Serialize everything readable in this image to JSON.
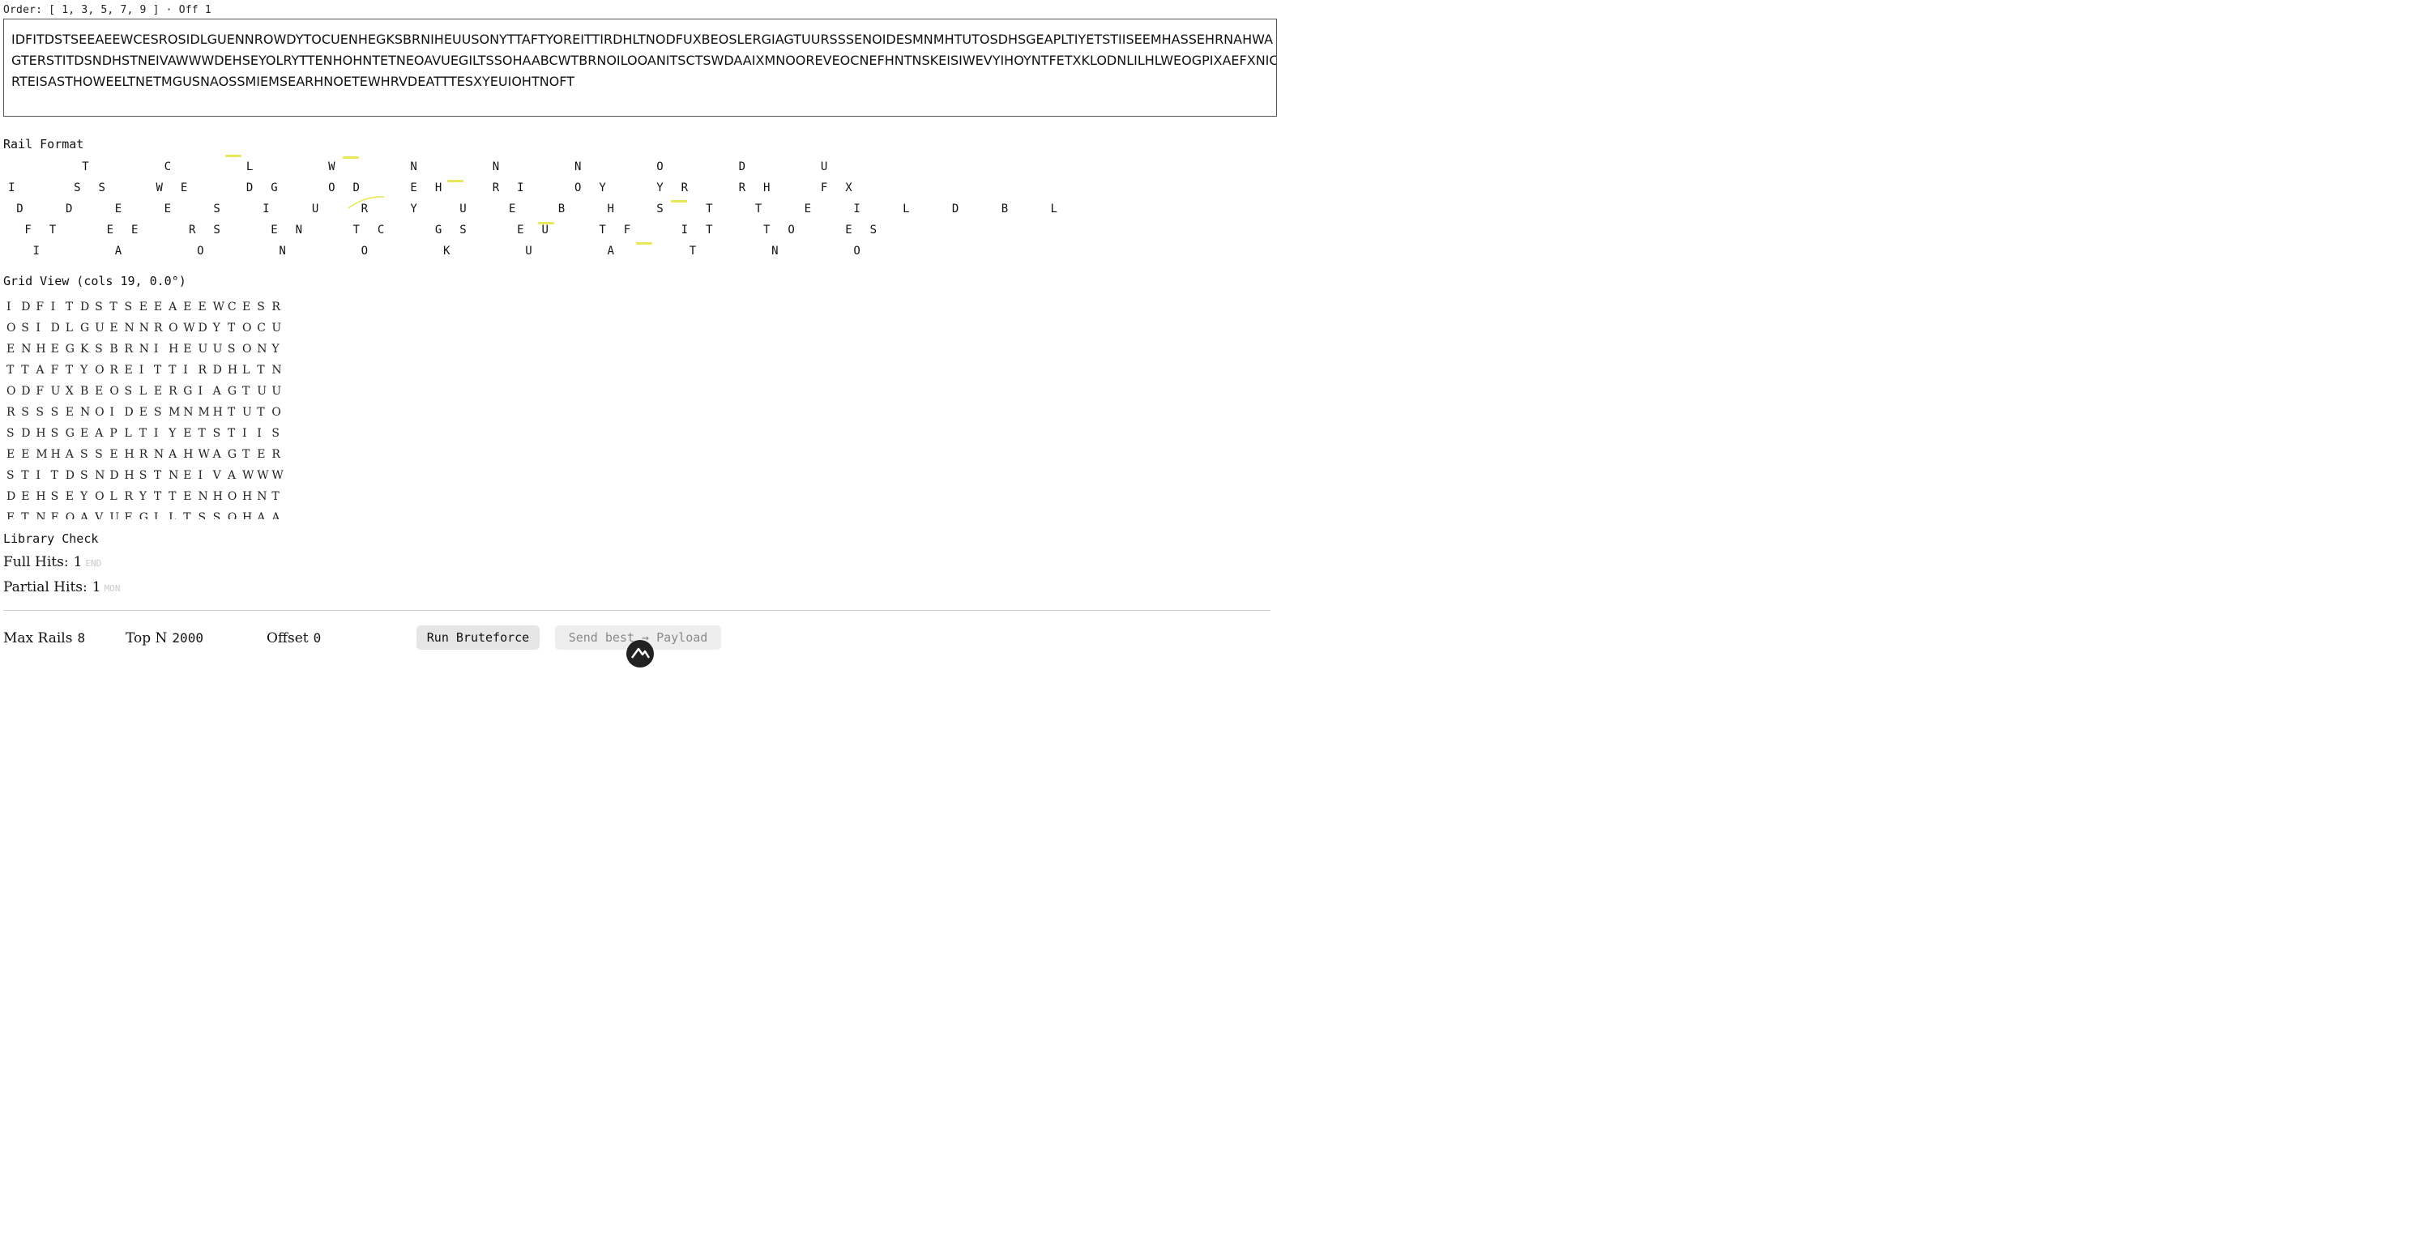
{
  "order_line": "Order: [ 1, 3, 5, 7, 9 ] · Off 1",
  "ciphertext": {
    "line1": "IDFITDSTSEEAEEWCESROSIDLGUENNROWDYTOCUENHEGKSBRNIHEUUSONYTTAFTYOREITTIRDHLTNODFUXBEOSLERGIAGTUURSSSENOIDESMNMHTUTOSDHSGEAPLTIYETSTIISEEMHASSEHRNAHWA",
    "line2": "GTERSTITDSNDHSTNEIVAWWWDEHSEYOLRYTTENHOHNTETNEOAVUEGILTSSOHAABCWTBRNOILOOANITSCTSWDAAIXMNOOREVEOCNEFHNTNSKEISIWEVYIHOYNTFETXKLODNLILHLWEOGPIXAEFXNIC",
    "line3": "RTEISASTHOWEELTNETMGUSNAOSSMIEMSEARHNOETEWHRVDEATTTESXYEUIOHTNOFT"
  },
  "rail_section": {
    "title": "Rail Format",
    "rows": [
      "          T         C         L         W         N         N         N         O         D         U",
      " I       S  S      W  E       D  G      O  D      E  H      R  I      O  Y      Y  R      R  H      F  X",
      "  D     D     E     E     S     I     U     R     Y     U     E     B     H     S     T     T     E     I     L     D     B     L",
      "   F  T      E  E      R  S      E  N      T  C      G  S      E  U      T  F      I  T      T  O      E  S",
      "    I         A         O         N         O         K         U         A         T         N         O"
    ]
  },
  "grid_section": {
    "title": "Grid View (cols 19, 0.0°)",
    "rows": [
      [
        "I",
        "D",
        "F",
        "I",
        "T",
        "D",
        "S",
        "T",
        "S",
        "E",
        "E",
        "A",
        "E",
        "E",
        "W",
        "C",
        "E",
        "S",
        "R"
      ],
      [
        "O",
        "S",
        "I",
        "D",
        "L",
        "G",
        "U",
        "E",
        "N",
        "N",
        "R",
        "O",
        "W",
        "D",
        "Y",
        "T",
        "O",
        "C",
        "U"
      ],
      [
        "E",
        "N",
        "H",
        "E",
        "G",
        "K",
        "S",
        "B",
        "R",
        "N",
        "I",
        "H",
        "E",
        "U",
        "U",
        "S",
        "O",
        "N",
        "Y"
      ],
      [
        "T",
        "T",
        "A",
        "F",
        "T",
        "Y",
        "O",
        "R",
        "E",
        "I",
        "T",
        "T",
        "I",
        "R",
        "D",
        "H",
        "L",
        "T",
        "N"
      ],
      [
        "O",
        "D",
        "F",
        "U",
        "X",
        "B",
        "E",
        "O",
        "S",
        "L",
        "E",
        "R",
        "G",
        "I",
        "A",
        "G",
        "T",
        "U",
        "U"
      ],
      [
        "R",
        "S",
        "S",
        "S",
        "E",
        "N",
        "O",
        "I",
        "D",
        "E",
        "S",
        "M",
        "N",
        "M",
        "H",
        "T",
        "U",
        "T",
        "O"
      ],
      [
        "S",
        "D",
        "H",
        "S",
        "G",
        "E",
        "A",
        "P",
        "L",
        "T",
        "I",
        "Y",
        "E",
        "T",
        "S",
        "T",
        "I",
        "I",
        "S"
      ],
      [
        "E",
        "E",
        "M",
        "H",
        "A",
        "S",
        "S",
        "E",
        "H",
        "R",
        "N",
        "A",
        "H",
        "W",
        "A",
        "G",
        "T",
        "E",
        "R"
      ],
      [
        "S",
        "T",
        "I",
        "T",
        "D",
        "S",
        "N",
        "D",
        "H",
        "S",
        "T",
        "N",
        "E",
        "I",
        "V",
        "A",
        "W",
        "W",
        "W"
      ],
      [
        "D",
        "E",
        "H",
        "S",
        "E",
        "Y",
        "O",
        "L",
        "R",
        "Y",
        "T",
        "T",
        "E",
        "N",
        "H",
        "O",
        "H",
        "N",
        "T"
      ],
      [
        "E",
        "T",
        "N",
        "E",
        "O",
        "A",
        "V",
        "U",
        "E",
        "G",
        "I",
        "L",
        "T",
        "S",
        "S",
        "O",
        "H",
        "A",
        "A"
      ]
    ]
  },
  "library": {
    "title": "Library Check",
    "full_label": "Full Hits:",
    "full_count": "1",
    "full_word": "END",
    "partial_label": "Partial Hits:",
    "partial_count": "1",
    "partial_word": "MON"
  },
  "controls": {
    "max_rails_label": "Max Rails",
    "max_rails_value": "8",
    "top_n_label": "Top N",
    "top_n_value": "2000",
    "offset_label": "Offset",
    "offset_value": "0",
    "run_label": "Run Bruteforce",
    "send_label": "Send best → Payload"
  },
  "colors": {
    "highlight": "#e9e75a",
    "button_bg": "#e6e6e6",
    "muted_text": "#8a8a8a"
  }
}
